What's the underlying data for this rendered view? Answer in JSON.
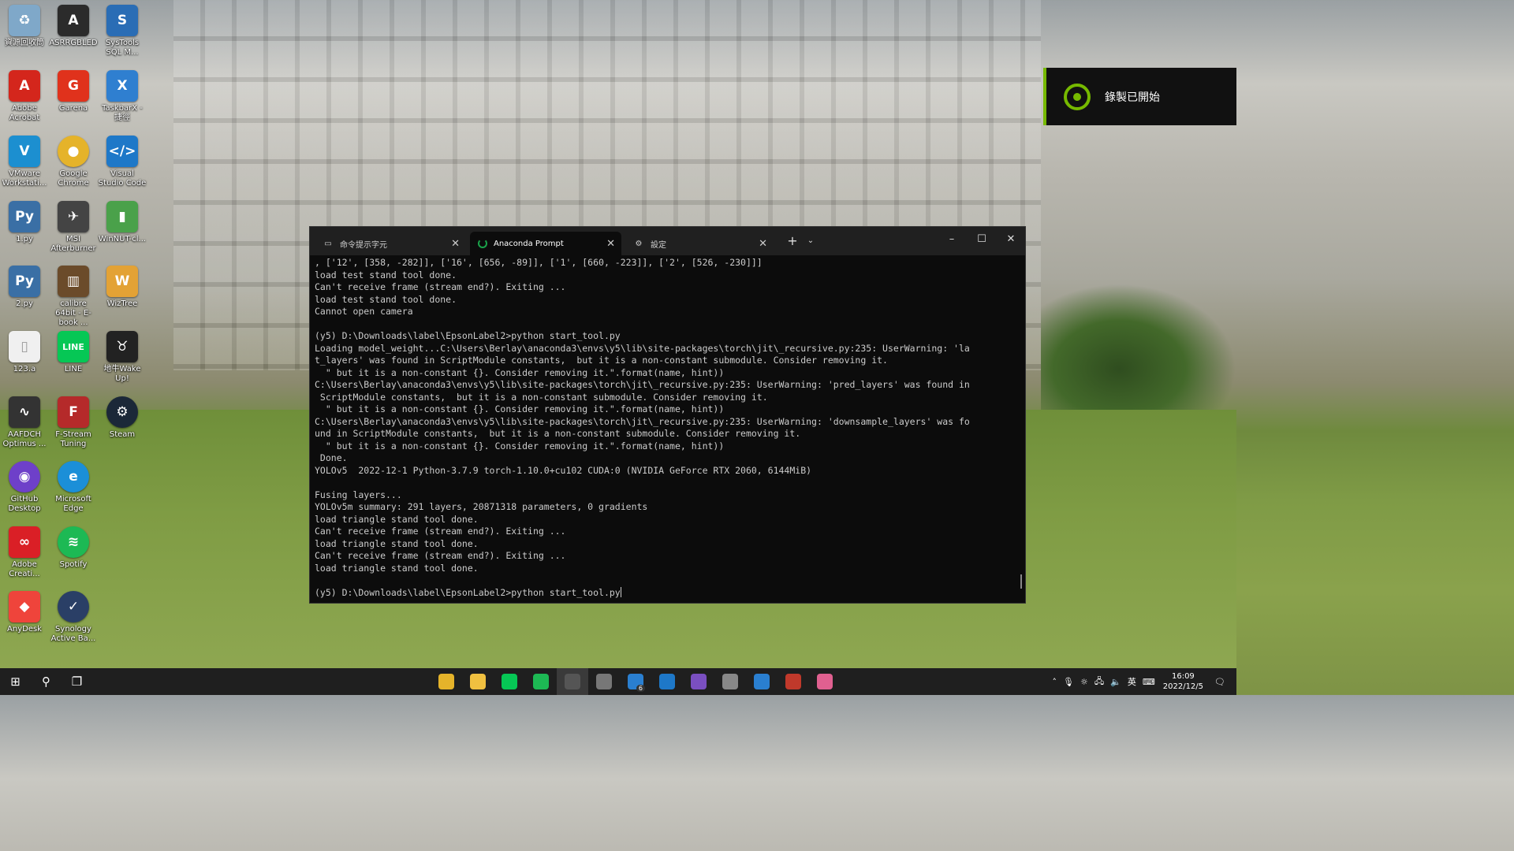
{
  "desktop": {
    "icons": [
      {
        "label": "資源回收筒",
        "icon": "recycle-bin-icon",
        "color": "#7fa8c9"
      },
      {
        "label": "ASRRGBLED",
        "icon": "asrock-icon",
        "color": "#2b2b2b"
      },
      {
        "label": "SysTools SQL M...",
        "icon": "systools-icon",
        "color": "#2a6db5"
      },
      {
        "label": "Adobe Acrobat",
        "icon": "acrobat-icon",
        "color": "#d4261c"
      },
      {
        "label": "Garena",
        "icon": "garena-icon",
        "color": "#e0321c"
      },
      {
        "label": "TaskbarX - 捷徑",
        "icon": "taskbarx-icon",
        "color": "#2f7fd0"
      },
      {
        "label": "VMware Workstati...",
        "icon": "vmware-icon",
        "color": "#1c8fd0"
      },
      {
        "label": "Google Chrome",
        "icon": "chrome-icon",
        "color": "#e5b32a"
      },
      {
        "label": "Visual Studio Code",
        "icon": "vscode-icon",
        "color": "#1e78c8"
      },
      {
        "label": "1.py",
        "icon": "python-file-icon",
        "color": "#3a6fa5"
      },
      {
        "label": "MSI Afterburner",
        "icon": "msi-afterburner-icon",
        "color": "#444"
      },
      {
        "label": "WinNUT-cl...",
        "icon": "winnut-icon",
        "color": "#4aa14a"
      },
      {
        "label": "2.py",
        "icon": "python-file-icon",
        "color": "#3a6fa5"
      },
      {
        "label": "calibre 64bit - E-book ...",
        "icon": "calibre-icon",
        "color": "#6b4b2a"
      },
      {
        "label": "WizTree",
        "icon": "wiztree-icon",
        "color": "#e3a235"
      },
      {
        "label": "123.a",
        "icon": "file-icon",
        "color": "#f0f0f0"
      },
      {
        "label": "LINE",
        "icon": "line-icon",
        "color": "#06c755"
      },
      {
        "label": "地牛Wake Up!",
        "icon": "earthquake-icon",
        "color": "#222"
      },
      {
        "label": "AAFDCH Optimus ...",
        "icon": "aafdch-icon",
        "color": "#333"
      },
      {
        "label": "F-Stream Tuning",
        "icon": "fstream-icon",
        "color": "#b52a2a"
      },
      {
        "label": "Steam",
        "icon": "steam-icon",
        "color": "#1b2838"
      },
      {
        "label": "GitHub Desktop",
        "icon": "github-icon",
        "color": "#6e40c9"
      },
      {
        "label": "Microsoft Edge",
        "icon": "edge-icon",
        "color": "#1b8fd8"
      },
      {
        "label": "Adobe Creati...",
        "icon": "creative-cloud-icon",
        "color": "#da1f26"
      },
      {
        "label": "Spotify",
        "icon": "spotify-icon",
        "color": "#1db954"
      },
      {
        "label": "AnyDesk",
        "icon": "anydesk-icon",
        "color": "#ef443b"
      },
      {
        "label": "Synology Active Ba...",
        "icon": "synology-icon",
        "color": "#2a3f66"
      }
    ]
  },
  "notification": {
    "text": "錄製已開始",
    "accent": "#76b900"
  },
  "terminal": {
    "tabs": [
      {
        "label": "命令提示字元",
        "icon": "cmd-icon"
      },
      {
        "label": "Anaconda Prompt",
        "icon": "loading-spinner-icon"
      },
      {
        "label": "設定",
        "icon": "gear-icon"
      }
    ],
    "lines": [
      ", ['12', [358, -282]], ['16', [656, -89]], ['1', [660, -223]], ['2', [526, -230]]]",
      "load test stand tool done.",
      "Can't receive frame (stream end?). Exiting ...",
      "load test stand tool done.",
      "Cannot open camera",
      "",
      "(y5) D:\\Downloads\\label\\EpsonLabel2>python start_tool.py",
      "Loading model_weight...C:\\Users\\Berlay\\anaconda3\\envs\\y5\\lib\\site-packages\\torch\\jit\\_recursive.py:235: UserWarning: 'la",
      "t_layers' was found in ScriptModule constants,  but it is a non-constant submodule. Consider removing it.",
      "  \" but it is a non-constant {}. Consider removing it.\".format(name, hint))",
      "C:\\Users\\Berlay\\anaconda3\\envs\\y5\\lib\\site-packages\\torch\\jit\\_recursive.py:235: UserWarning: 'pred_layers' was found in",
      " ScriptModule constants,  but it is a non-constant submodule. Consider removing it.",
      "  \" but it is a non-constant {}. Consider removing it.\".format(name, hint))",
      "C:\\Users\\Berlay\\anaconda3\\envs\\y5\\lib\\site-packages\\torch\\jit\\_recursive.py:235: UserWarning: 'downsample_layers' was fo",
      "und in ScriptModule constants,  but it is a non-constant submodule. Consider removing it.",
      "  \" but it is a non-constant {}. Consider removing it.\".format(name, hint))",
      " Done.",
      "YOLOv5  2022-12-1 Python-3.7.9 torch-1.10.0+cu102 CUDA:0 (NVIDIA GeForce RTX 2060, 6144MiB)",
      "",
      "Fusing layers...",
      "YOLOv5m summary: 291 layers, 20871318 parameters, 0 gradients",
      "load triangle stand tool done.",
      "Can't receive frame (stream end?). Exiting ...",
      "load triangle stand tool done.",
      "Can't receive frame (stream end?). Exiting ...",
      "load triangle stand tool done.",
      ""
    ],
    "prompt": "(y5) D:\\Downloads\\label\\EpsonLabel2>python start_tool.py"
  },
  "taskbar": {
    "apps": [
      {
        "icon": "chrome-icon",
        "color": "#e5b32a"
      },
      {
        "icon": "file-explorer-icon",
        "color": "#f0c040"
      },
      {
        "icon": "line-icon",
        "color": "#06c755"
      },
      {
        "icon": "spotify-icon",
        "color": "#1db954"
      },
      {
        "icon": "terminal-icon",
        "color": "#555"
      },
      {
        "icon": "chatgpt-icon",
        "color": "#777"
      },
      {
        "icon": "mail-icon",
        "color": "#2a7fd0"
      },
      {
        "icon": "vscode-icon",
        "color": "#1e78c8"
      },
      {
        "icon": "visual-studio-icon",
        "color": "#7a4fc0"
      },
      {
        "icon": "settings-icon",
        "color": "#888"
      },
      {
        "icon": "app-blue-icon",
        "color": "#2a7fd0"
      },
      {
        "icon": "app-red-icon",
        "color": "#c0392b"
      },
      {
        "icon": "app-drop-icon",
        "color": "#e06090"
      }
    ],
    "mail_badge": "6",
    "ime": "英",
    "time": "16:09",
    "date": "2022/12/5"
  }
}
